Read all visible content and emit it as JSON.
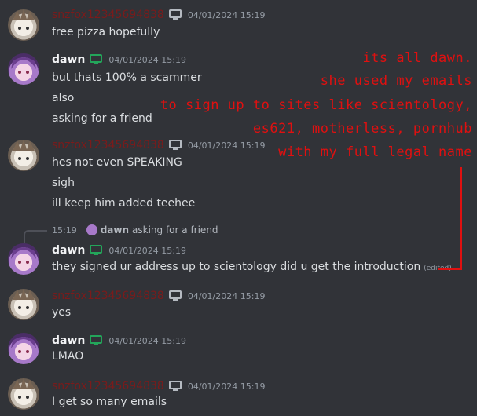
{
  "users": {
    "fox": "snzfox12345694838",
    "dawn": "dawn"
  },
  "messages": [
    {
      "user": "snzfox12345694838",
      "timestamp": "04/01/2024 15:19",
      "lines": [
        "free pizza hopefully"
      ]
    },
    {
      "user": "dawn",
      "timestamp": "04/01/2024 15:19",
      "lines": [
        "but thats 100% a scammer",
        "also",
        "asking for a friend"
      ]
    },
    {
      "user": "snzfox12345694838",
      "timestamp": "04/01/2024 15:19",
      "lines": [
        "hes not even SPEAKING",
        "sigh",
        "ill keep him added teehee"
      ]
    },
    {
      "user": "dawn",
      "timestamp": "04/01/2024 15:19",
      "reply": {
        "time": "15:19",
        "name": "dawn",
        "text": "asking for a friend"
      },
      "lines": [
        "they signed ur address up to scientology did u get the introduction"
      ],
      "edited": "(edited)"
    },
    {
      "user": "snzfox12345694838",
      "timestamp": "04/01/2024 15:19",
      "lines": [
        "yes"
      ]
    },
    {
      "user": "dawn",
      "timestamp": "04/01/2024 15:19",
      "lines": [
        "LMAO"
      ]
    },
    {
      "user": "snzfox12345694838",
      "timestamp": "04/01/2024 15:19",
      "lines": [
        "I get so many emails"
      ]
    }
  ],
  "annotation": {
    "lines": [
      "its all dawn.",
      "she used my emails",
      "to sign up to sites like scientology,",
      "es621, motherless, pornhub",
      "with my full legal name"
    ],
    "color": "#e01010"
  },
  "colors": {
    "background": "#313338",
    "fox_name": "#7a1b1b",
    "dawn_name": "#f2f3f5",
    "timestamp": "#949ba4",
    "monitor_icon_fox": "#b5bac1",
    "monitor_icon_dawn": "#23a55a"
  }
}
